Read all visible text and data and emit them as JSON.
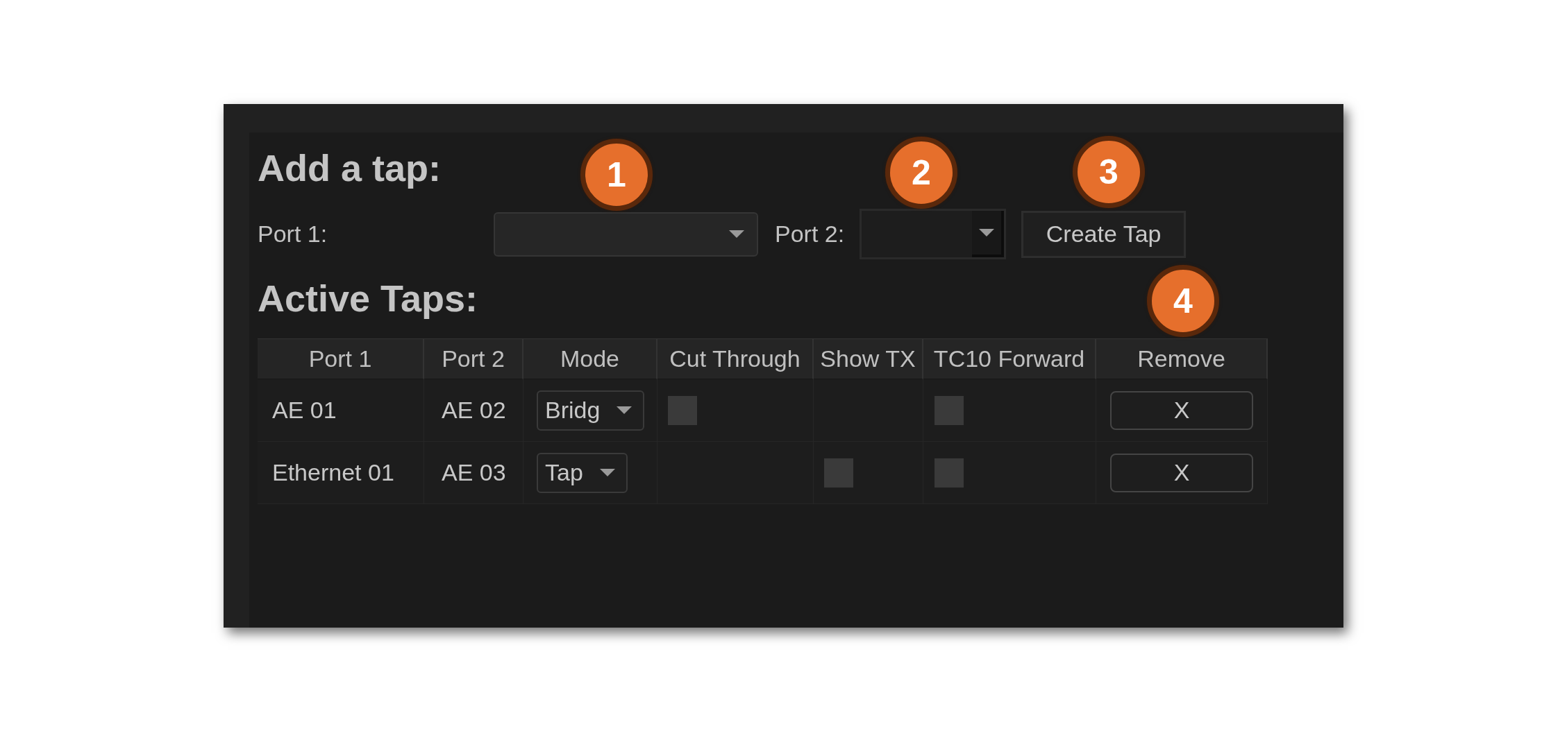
{
  "add_tap": {
    "title": "Add a tap:",
    "port_1": {
      "label": "Port 1:"
    },
    "port_2": {
      "label": "Port 2:"
    },
    "create_button": "Create Tap"
  },
  "active_taps": {
    "title": "Active Taps:",
    "columns": [
      "Port 1",
      "Port 2",
      "Mode",
      "Cut Through",
      "Show TX",
      "TC10 Forward",
      "Remove"
    ],
    "rows": [
      {
        "port_1": "AE 01",
        "port_2": "AE 02",
        "mode": "Bridg",
        "cut_through": {
          "checked": false
        },
        "tc10_forward": {
          "checked": false
        },
        "remove": "X"
      },
      {
        "port_1": "Ethernet 01",
        "port_2": "AE 03",
        "mode": "Tap",
        "show_tx": {
          "checked": false
        },
        "tc10_forward": {
          "checked": false
        },
        "remove": "X"
      }
    ]
  },
  "callouts": [
    {
      "label": "1"
    },
    {
      "label": "2"
    },
    {
      "label": "3"
    },
    {
      "label": "4"
    }
  ]
}
